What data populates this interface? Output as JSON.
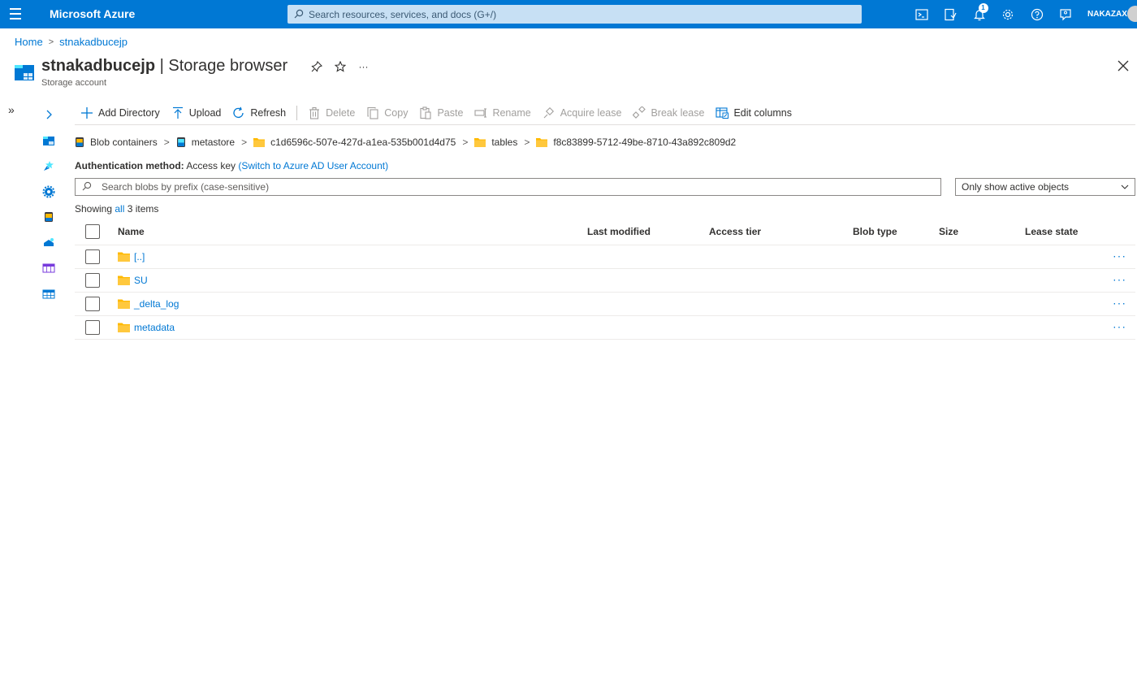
{
  "topbar": {
    "brand": "Microsoft Azure",
    "search_placeholder": "Search resources, services, and docs (G+/)",
    "notification_count": "1",
    "username": "NAKAZAX",
    "icons": [
      "cloud-shell-icon",
      "directory-filter-icon",
      "bell-icon",
      "gear-icon",
      "help-icon",
      "feedback-icon"
    ]
  },
  "breadcrumb": [
    "Home",
    "stnakadbucejp"
  ],
  "header": {
    "resource_name": "stnakadbucejp",
    "page_name": "Storage browser",
    "title_sep": " | ",
    "subtitle": "Storage account"
  },
  "commands": [
    {
      "label": "Add Directory",
      "icon": "plus-icon",
      "enabled": true
    },
    {
      "label": "Upload",
      "icon": "upload-icon",
      "enabled": true
    },
    {
      "label": "Refresh",
      "icon": "refresh-icon",
      "enabled": true
    },
    {
      "label": "Delete",
      "icon": "trash-icon",
      "enabled": false
    },
    {
      "label": "Copy",
      "icon": "copy-icon",
      "enabled": false
    },
    {
      "label": "Paste",
      "icon": "paste-icon",
      "enabled": false
    },
    {
      "label": "Rename",
      "icon": "rename-icon",
      "enabled": false
    },
    {
      "label": "Acquire lease",
      "icon": "link-icon",
      "enabled": false
    },
    {
      "label": "Break lease",
      "icon": "break-link-icon",
      "enabled": false
    },
    {
      "label": "Edit columns",
      "icon": "columns-icon",
      "enabled": true
    }
  ],
  "path": [
    {
      "label": "Blob containers",
      "icon": "storage-icon"
    },
    {
      "label": "metastore",
      "icon": "container-icon"
    },
    {
      "label": "c1d6596c-507e-427d-a1ea-535b001d4d75",
      "icon": "folder-icon"
    },
    {
      "label": "tables",
      "icon": "folder-icon"
    },
    {
      "label": "f8c83899-5712-49be-8710-43a892c809d2",
      "icon": "folder-icon"
    }
  ],
  "auth": {
    "label": "Authentication method:",
    "value": "Access key",
    "switch_link": "(Switch to Azure AD User Account)"
  },
  "blob_search": {
    "placeholder": "Search blobs by prefix (case-sensitive)"
  },
  "filter": {
    "selected": "Only show active objects"
  },
  "showing": {
    "prefix": "Showing",
    "all": "all",
    "count_text": "3 items"
  },
  "table": {
    "columns": [
      "Name",
      "Last modified",
      "Access tier",
      "Blob type",
      "Size",
      "Lease state"
    ],
    "rows": [
      {
        "name": "[..]",
        "more": "···"
      },
      {
        "name": "SU",
        "more": "···"
      },
      {
        "name": "_delta_log",
        "more": "···"
      },
      {
        "name": "metadata",
        "more": "···"
      }
    ]
  },
  "colors": {
    "accent": "#0078d4",
    "folder": "#ffb900"
  }
}
